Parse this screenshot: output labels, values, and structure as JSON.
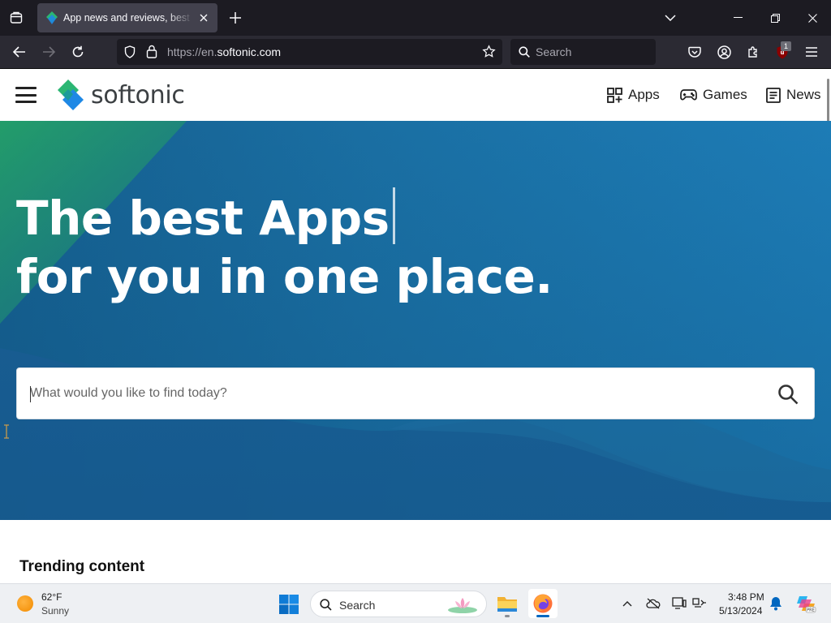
{
  "browser": {
    "tab": {
      "title": "App news and reviews, best software downloads and discovery - Softonic"
    },
    "url": {
      "scheme": "https://en.",
      "host": "softonic.com"
    },
    "search_placeholder": "Search",
    "extension_badge": "1"
  },
  "site": {
    "logo_text": "softonic",
    "nav": [
      {
        "label": "Apps",
        "icon": "apps-grid-icon"
      },
      {
        "label": "Games",
        "icon": "gamepad-icon"
      },
      {
        "label": "News",
        "icon": "newspaper-icon"
      }
    ],
    "hero": {
      "title_line1": "The best Apps",
      "title_line2": "for you in one place.",
      "search_placeholder": "What would you like to find today?"
    },
    "trending_heading": "Trending content"
  },
  "taskbar": {
    "weather": {
      "temp": "62°F",
      "condition": "Sunny"
    },
    "search_label": "Search",
    "clock": {
      "time": "3:48 PM",
      "date": "5/13/2024"
    }
  },
  "colors": {
    "browser_tabstrip": "#1c1b22",
    "browser_toolbar": "#2b2a33",
    "hero_blue": "#1a6fa3",
    "brand_green": "#2bb673",
    "brand_blue": "#1e88e5"
  }
}
